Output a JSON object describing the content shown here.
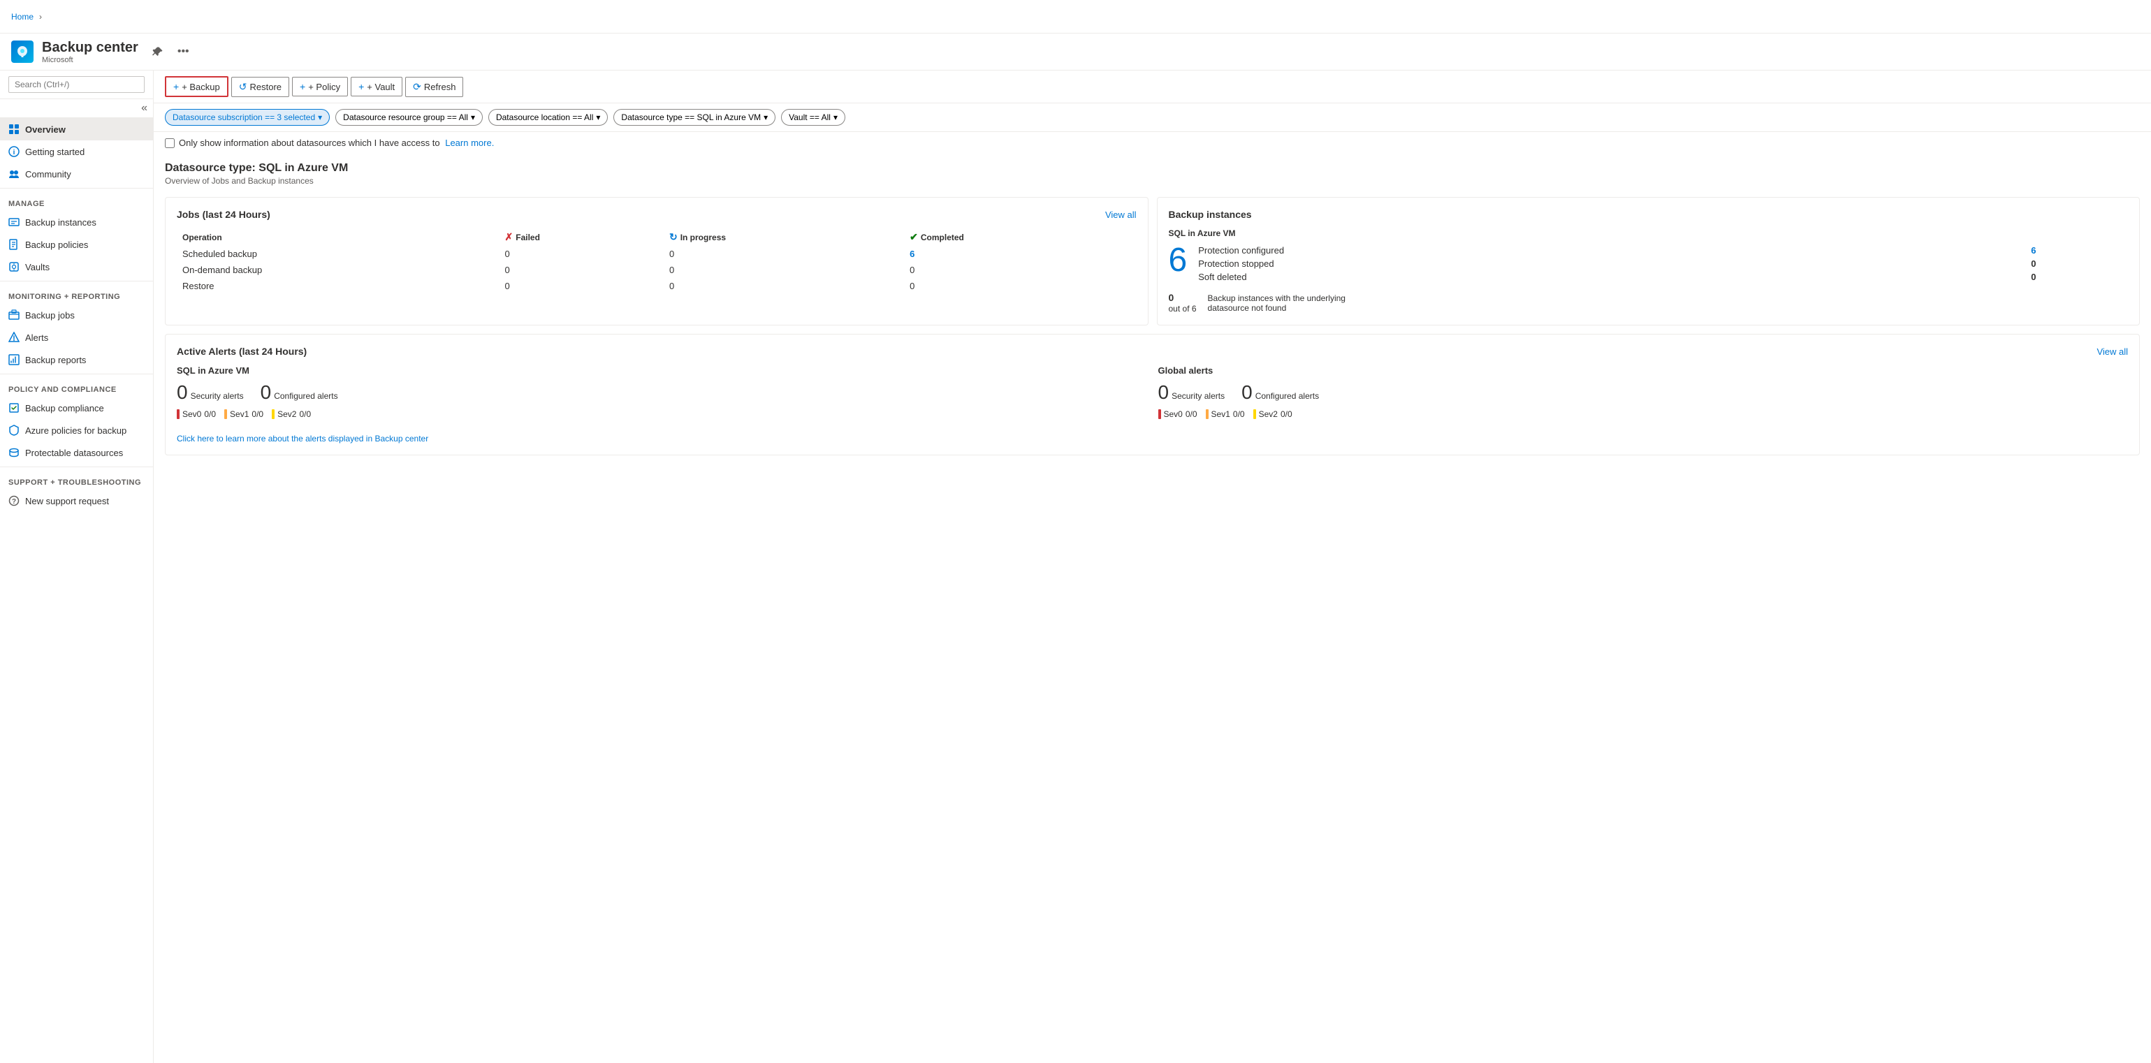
{
  "breadcrumb": {
    "home": "Home",
    "sep": "›"
  },
  "app": {
    "title": "Backup center",
    "subtitle": "Microsoft",
    "pin_label": "Pin",
    "more_label": "More"
  },
  "toolbar": {
    "backup_label": "+ Backup",
    "restore_label": "Restore",
    "policy_label": "+ Policy",
    "vault_label": "+ Vault",
    "refresh_label": "Refresh"
  },
  "filters": [
    {
      "label": "Datasource subscription == 3 selected",
      "active": true
    },
    {
      "label": "Datasource resource group == All",
      "active": false
    },
    {
      "label": "Datasource location == All",
      "active": false
    },
    {
      "label": "Datasource type == SQL in Azure VM",
      "active": false
    },
    {
      "label": "Vault == All",
      "active": false
    }
  ],
  "checkbox": {
    "label": "Only show information about datasources which I have access to",
    "link_text": "Learn more."
  },
  "section": {
    "title": "Datasource type: SQL in Azure VM",
    "subtitle": "Overview of Jobs and Backup instances"
  },
  "jobs_card": {
    "title": "Jobs (last 24 Hours)",
    "view_all": "View all",
    "columns": {
      "operation": "Operation",
      "failed": "Failed",
      "in_progress": "In progress",
      "completed": "Completed"
    },
    "rows": [
      {
        "operation": "Scheduled backup",
        "failed": "0",
        "in_progress": "0",
        "completed": "6"
      },
      {
        "operation": "On-demand backup",
        "failed": "0",
        "in_progress": "0",
        "completed": "0"
      },
      {
        "operation": "Restore",
        "failed": "0",
        "in_progress": "0",
        "completed": "0"
      }
    ]
  },
  "backup_instances_card": {
    "title": "Backup instances",
    "datasource_type": "SQL in Azure VM",
    "total_number": "6",
    "protection_configured": {
      "label": "Protection configured",
      "value": "6"
    },
    "protection_stopped": {
      "label": "Protection stopped",
      "value": "0"
    },
    "soft_deleted": {
      "label": "Soft deleted",
      "value": "0"
    },
    "footer_count": "0",
    "footer_denominator": "out of 6",
    "footer_text": "Backup instances with the underlying datasource not found"
  },
  "alerts_card": {
    "title": "Active Alerts (last 24 Hours)",
    "view_all": "View all",
    "sql_section": {
      "title": "SQL in Azure VM",
      "security_alerts": {
        "count": "0",
        "label": "Security alerts"
      },
      "configured_alerts": {
        "count": "0",
        "label": "Configured alerts"
      },
      "sevs": [
        {
          "label": "Sev0",
          "value": "0/0"
        },
        {
          "label": "Sev1",
          "value": "0/0"
        },
        {
          "label": "Sev2",
          "value": "0/0"
        }
      ]
    },
    "global_section": {
      "title": "Global alerts",
      "security_alerts": {
        "count": "0",
        "label": "Security alerts"
      },
      "configured_alerts": {
        "count": "0",
        "label": "Configured alerts"
      },
      "sevs": [
        {
          "label": "Sev0",
          "value": "0/0"
        },
        {
          "label": "Sev1",
          "value": "0/0"
        },
        {
          "label": "Sev2",
          "value": "0/0"
        }
      ]
    },
    "footer_link": "Click here to learn more about the alerts displayed in Backup center"
  },
  "sidebar": {
    "search_placeholder": "Search (Ctrl+/)",
    "nav_items": [
      {
        "id": "overview",
        "label": "Overview",
        "section": null,
        "active": true
      },
      {
        "id": "getting-started",
        "label": "Getting started",
        "section": null
      },
      {
        "id": "community",
        "label": "Community",
        "section": null
      }
    ],
    "manage_section": "Manage",
    "manage_items": [
      {
        "id": "backup-instances",
        "label": "Backup instances"
      },
      {
        "id": "backup-policies",
        "label": "Backup policies"
      },
      {
        "id": "vaults",
        "label": "Vaults"
      }
    ],
    "monitoring_section": "Monitoring + reporting",
    "monitoring_items": [
      {
        "id": "backup-jobs",
        "label": "Backup jobs"
      },
      {
        "id": "alerts",
        "label": "Alerts"
      },
      {
        "id": "backup-reports",
        "label": "Backup reports"
      }
    ],
    "policy_section": "Policy and compliance",
    "policy_items": [
      {
        "id": "backup-compliance",
        "label": "Backup compliance"
      },
      {
        "id": "azure-policies",
        "label": "Azure policies for backup"
      },
      {
        "id": "protectable-datasources",
        "label": "Protectable datasources"
      }
    ],
    "support_section": "Support + troubleshooting",
    "support_items": [
      {
        "id": "new-support-request",
        "label": "New support request"
      }
    ]
  }
}
